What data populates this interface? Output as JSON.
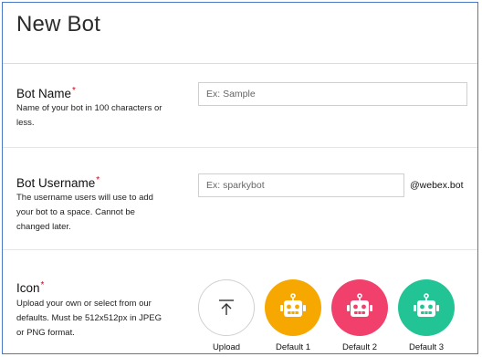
{
  "page": {
    "title": "New Bot"
  },
  "bot_name": {
    "label": "Bot Name",
    "required_mark": "*",
    "help": "Name of your bot in 100 characters or less.",
    "placeholder": "Ex: Sample",
    "value": ""
  },
  "bot_username": {
    "label": "Bot Username",
    "required_mark": "*",
    "help": "The username users will use to add your bot to a space. Cannot be changed later.",
    "placeholder": "Ex: sparkybot",
    "value": "",
    "suffix": "@webex.bot"
  },
  "icon": {
    "label": "Icon",
    "required_mark": "*",
    "help": "Upload your own or select from our defaults. Must be 512x512px in JPEG or PNG format.",
    "options": [
      {
        "label": "Upload",
        "icon": "upload-icon"
      },
      {
        "label": "Default 1",
        "icon": "robot-icon",
        "color": "#f7a800"
      },
      {
        "label": "Default 2",
        "icon": "robot-icon",
        "color": "#f0406b"
      },
      {
        "label": "Default 3",
        "icon": "robot-icon",
        "color": "#22c496"
      }
    ]
  }
}
